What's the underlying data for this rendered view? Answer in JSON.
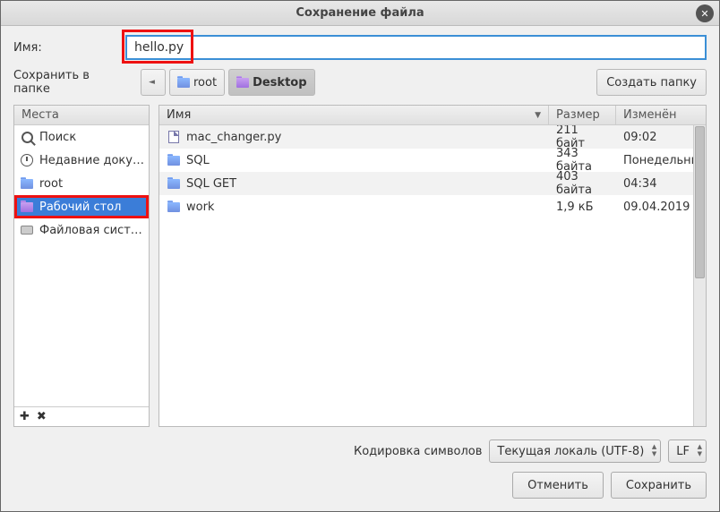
{
  "title": "Сохранение файла",
  "name_label": "Имя:",
  "filename": "hello.py",
  "folder_label": "Сохранить в папке",
  "path": {
    "back": "◄",
    "root": "root",
    "desktop": "Desktop"
  },
  "create_folder": "Создать папку",
  "places_header": "Места",
  "places": [
    {
      "label": "Поиск",
      "icon": "search"
    },
    {
      "label": "Недавние доку…",
      "icon": "clock"
    },
    {
      "label": "root",
      "icon": "folder"
    },
    {
      "label": "Рабочий стол",
      "icon": "folder-purple",
      "selected": true,
      "highlight": true
    },
    {
      "label": "Файловая сист…",
      "icon": "disk"
    }
  ],
  "cols": {
    "name": "Имя",
    "size": "Размер",
    "mod": "Изменён"
  },
  "files": [
    {
      "name": "mac_changer.py",
      "size": "211 байт",
      "mod": "09:02",
      "type": "file"
    },
    {
      "name": "SQL",
      "size": "343 байта",
      "mod": "Понедельник",
      "type": "folder"
    },
    {
      "name": "SQL GET",
      "size": "403 байта",
      "mod": "04:34",
      "type": "folder"
    },
    {
      "name": "work",
      "size": "1,9 кБ",
      "mod": "09.04.2019",
      "type": "folder"
    }
  ],
  "encoding_label": "Кодировка символов",
  "encoding_value": "Текущая локаль (UTF-8)",
  "lineend": "LF",
  "cancel": "Отменить",
  "save": "Сохранить"
}
